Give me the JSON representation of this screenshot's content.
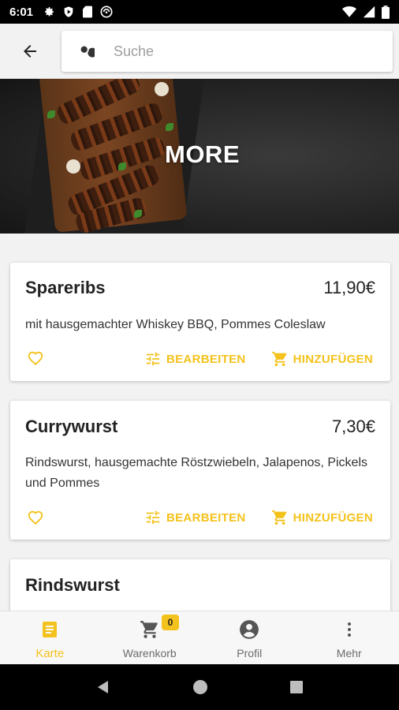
{
  "status_bar": {
    "time": "6:01"
  },
  "search": {
    "placeholder": "Suche",
    "value": ""
  },
  "hero": {
    "title": "MORE"
  },
  "items": [
    {
      "name": "Spareribs",
      "price": "11,90€",
      "description": "mit hausgemachter Whiskey BBQ, Pommes Coleslaw",
      "favorite": false
    },
    {
      "name": "Currywurst",
      "price": "7,30€",
      "description": "Rindswurst, hausgemachte Röstzwiebeln, Jalapenos, Pickels und Pommes",
      "favorite": false
    },
    {
      "name": "Rindswurst",
      "price": "",
      "description": "",
      "favorite": false
    }
  ],
  "actions": {
    "edit_label": "BEARBEITEN",
    "add_label": "HINZUFÜGEN"
  },
  "bottom_nav": {
    "items": [
      {
        "label": "Karte",
        "icon": "menu-card-icon",
        "active": true
      },
      {
        "label": "Warenkorb",
        "icon": "cart-icon",
        "badge": "0"
      },
      {
        "label": "Profil",
        "icon": "account-icon"
      },
      {
        "label": "Mehr",
        "icon": "more-vert-icon"
      }
    ]
  },
  "colors": {
    "accent": "#f4c21c",
    "background": "#f2f2f2",
    "card": "#ffffff",
    "text": "#222222"
  }
}
